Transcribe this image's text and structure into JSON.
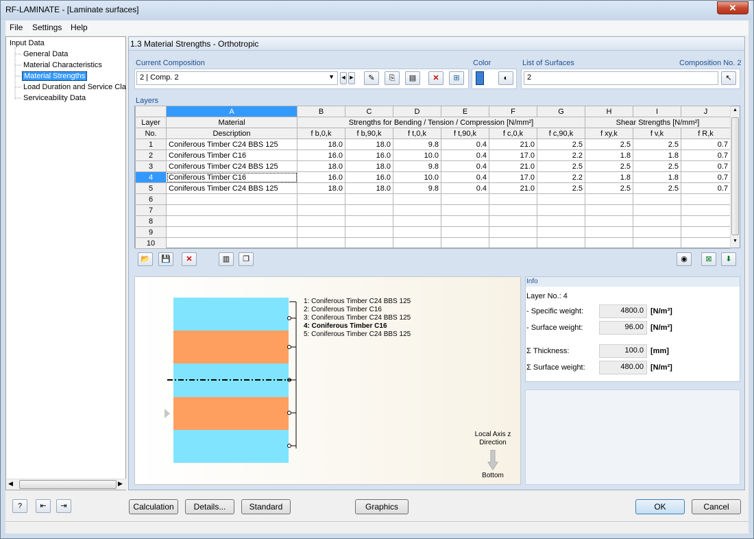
{
  "window": {
    "title": "RF-LAMINATE - [Laminate surfaces]",
    "close": "✕"
  },
  "menu": [
    "File",
    "Settings",
    "Help"
  ],
  "nav": {
    "root": "Input Data",
    "items": [
      "General Data",
      "Material Characteristics",
      "Material Strengths",
      "Load Duration and Service Clas",
      "Serviceability Data"
    ],
    "selected_index": 2
  },
  "header": "1.3 Material Strengths - Orthotropic",
  "current_composition": {
    "label": "Current Composition",
    "value": "2 | Comp. 2"
  },
  "color": {
    "label": "Color",
    "swatch": "#3a7fd5"
  },
  "surfaces": {
    "label": "List of Surfaces",
    "composition": "Composition No. 2",
    "value": "2"
  },
  "layers": {
    "label": "Layers",
    "col_letters": [
      "A",
      "B",
      "C",
      "D",
      "E",
      "F",
      "G",
      "H",
      "I",
      "J"
    ],
    "hdr_layer": "Layer",
    "hdr_no": "No.",
    "hdr_material": "Material",
    "hdr_description": "Description",
    "hdr_strengths": "Strengths for Bending / Tension / Compression [N/mm²]",
    "hdr_shear": "Shear Strengths [N/mm²]",
    "sub": [
      "f b,0,k",
      "f b,90,k",
      "f t,0,k",
      "f t,90,k",
      "f c,0,k",
      "f c,90,k",
      "f xy,k",
      "f v,k",
      "f R,k"
    ],
    "rows": [
      {
        "no": "1",
        "desc": "Coniferous Timber C24 BBS 125",
        "v": [
          "18.0",
          "18.0",
          "9.8",
          "0.4",
          "21.0",
          "2.5",
          "2.5",
          "2.5",
          "0.7"
        ]
      },
      {
        "no": "2",
        "desc": "Coniferous Timber C16",
        "v": [
          "16.0",
          "16.0",
          "10.0",
          "0.4",
          "17.0",
          "2.2",
          "1.8",
          "1.8",
          "0.7"
        ]
      },
      {
        "no": "3",
        "desc": "Coniferous Timber C24 BBS 125",
        "v": [
          "18.0",
          "18.0",
          "9.8",
          "0.4",
          "21.0",
          "2.5",
          "2.5",
          "2.5",
          "0.7"
        ]
      },
      {
        "no": "4",
        "desc": "Coniferous Timber C16",
        "v": [
          "16.0",
          "16.0",
          "10.0",
          "0.4",
          "17.0",
          "2.2",
          "1.8",
          "1.8",
          "0.7"
        ]
      },
      {
        "no": "5",
        "desc": "Coniferous Timber C24 BBS 125",
        "v": [
          "18.0",
          "18.0",
          "9.8",
          "0.4",
          "21.0",
          "2.5",
          "2.5",
          "2.5",
          "0.7"
        ]
      },
      {
        "no": "6",
        "desc": "",
        "v": [
          "",
          "",
          "",
          "",
          "",
          "",
          "",
          "",
          ""
        ]
      },
      {
        "no": "7",
        "desc": "",
        "v": [
          "",
          "",
          "",
          "",
          "",
          "",
          "",
          "",
          ""
        ]
      },
      {
        "no": "8",
        "desc": "",
        "v": [
          "",
          "",
          "",
          "",
          "",
          "",
          "",
          "",
          ""
        ]
      },
      {
        "no": "9",
        "desc": "",
        "v": [
          "",
          "",
          "",
          "",
          "",
          "",
          "",
          "",
          ""
        ]
      },
      {
        "no": "10",
        "desc": "",
        "v": [
          "",
          "",
          "",
          "",
          "",
          "",
          "",
          "",
          ""
        ]
      }
    ],
    "selected_row": 3
  },
  "graphic": {
    "legend": [
      "1: Coniferous Timber C24 BBS 125",
      "2: Coniferous Timber C16",
      "3: Coniferous Timber C24 BBS 125",
      "4: Coniferous Timber C16",
      "5: Coniferous Timber C24 BBS 125"
    ],
    "bold_index": 3,
    "axis_l1": "Local Axis z",
    "axis_l2": "Direction",
    "bottom": "Bottom",
    "layer_colors": [
      "#80e4ff",
      "#ff9f5f",
      "#80e4ff",
      "#ff9f5f",
      "#80e4ff"
    ]
  },
  "info": {
    "title": "Info",
    "layer_no": "Layer No.: 4",
    "specific_weight": {
      "label": "- Specific weight:",
      "value": "4800.0",
      "unit": "[N/m³]"
    },
    "surface_weight": {
      "label": "- Surface weight:",
      "value": "96.00",
      "unit": "[N/m²]"
    },
    "thickness": {
      "label": "Σ Thickness:",
      "value": "100.0",
      "unit": "[mm]"
    },
    "sum_surface_weight": {
      "label": "Σ Surface weight:",
      "value": "480.00",
      "unit": "[N/m²]"
    }
  },
  "buttons": {
    "calculation": "Calculation",
    "details": "Details...",
    "standard": "Standard",
    "graphics": "Graphics",
    "ok": "OK",
    "cancel": "Cancel"
  }
}
